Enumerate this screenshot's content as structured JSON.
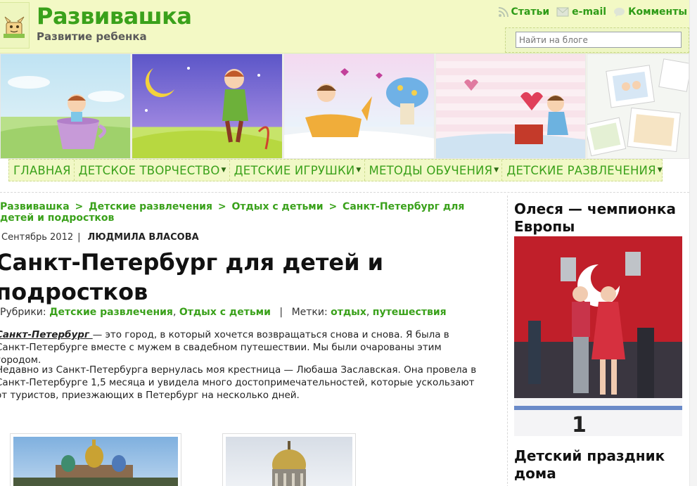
{
  "site": {
    "title": "Развивашка",
    "subtitle": "Развитие ребенка"
  },
  "toplinks": [
    {
      "label": "Статьи",
      "icon": "rss-icon"
    },
    {
      "label": "e-mail",
      "icon": "mail-icon"
    },
    {
      "label": "Комменты",
      "icon": "comments-icon"
    }
  ],
  "search": {
    "placeholder": "Найти на блоге"
  },
  "nav": [
    {
      "label": "ГЛАВНАЯ",
      "has_menu": false
    },
    {
      "label": "ДЕТСКОЕ ТВОРЧЕСТВО",
      "has_menu": true
    },
    {
      "label": "ДЕТСКИЕ ИГРУШКИ",
      "has_menu": true
    },
    {
      "label": "МЕТОДЫ ОБУЧЕНИЯ",
      "has_menu": true
    },
    {
      "label": "ДЕТСКИЕ РАЗВЛЕЧЕНИЯ",
      "has_menu": true
    }
  ],
  "breadcrumbs": [
    "Развивашка",
    "Детские развлечения",
    "Отдых с детьми",
    "Санкт-Петербург для детей и подростков"
  ],
  "breadcrumb_sep": ">",
  "post": {
    "date": "Сентябрь 2012",
    "author": "ЛЮДМИЛА ВЛАСОВА",
    "title": "Санкт-Петербург для детей и подростков",
    "cats_label": "Рубрики:",
    "cats": [
      "Детские развлечения",
      "Отдых с детьми"
    ],
    "tags_label": "Метки:",
    "tags": [
      "отдых",
      "путешествия"
    ],
    "p1_lead": "Санкт-Петербург ",
    "p1_rest": "— это город, в который хочется возвращаться снова и снова. Я была в Санкт-Петербурге вместе с мужем в свадебном путешествии. Мы были очарованы этим городом.",
    "p2": "Недавно из Санкт-Петербурга вернулась моя крестница — Любаша Заславская. Она провела в Санкт-Петербурге 1,5 месяца и увидела много достопримечательностей, которые ускользают от туристов, приезжающих в Петербург на несколько дней."
  },
  "sidebar": {
    "w1_title": "Олеся — чемпионка Европы",
    "w2_title": "Детский праздник дома"
  },
  "colors": {
    "brand_green": "#3aa11b",
    "header_bg": "#f3f9c5"
  }
}
